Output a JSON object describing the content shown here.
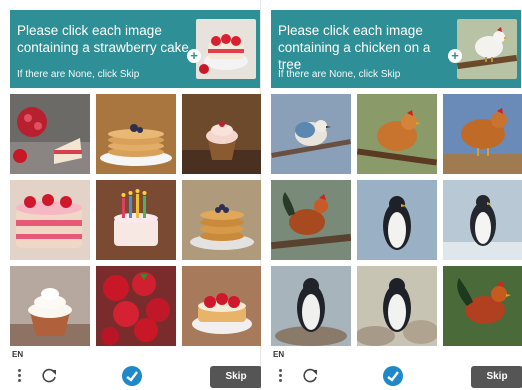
{
  "panels": [
    {
      "prompt": "Please click each image containing a strawberry cake",
      "hint": "If there are None, click Skip",
      "language": "EN",
      "skip_label": "Skip",
      "example_icon": "strawberry-cake-icon",
      "tiles": [
        "strawberries-cake-slice",
        "pancakes-stack",
        "cupcake",
        "strawberry-layer-cake",
        "birthday-cake-candles",
        "pancakes-blueberries",
        "cupcake-white-frosting",
        "strawberries-bowl",
        "strawberry-tart"
      ]
    },
    {
      "prompt": "Please click each image containing a chicken on a tree",
      "hint": "If there are None, click Skip",
      "language": "EN",
      "skip_label": "Skip",
      "example_icon": "chicken-on-tree-icon",
      "tiles": [
        "bird-on-branch",
        "hen-on-branch",
        "hen-walking",
        "rooster-on-branch",
        "penguin-standing",
        "penguin-snow",
        "penguin-rock",
        "penguin-rocks",
        "rooster-colorful"
      ]
    }
  ],
  "colors": {
    "header": "#2f8f96",
    "skip_button": "#555555",
    "brand": "#1e88c8"
  }
}
